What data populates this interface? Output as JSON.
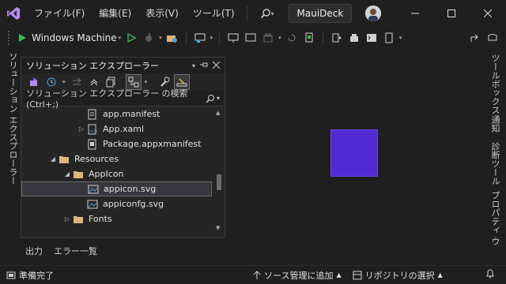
{
  "menu": [
    "ファイル(F)",
    "編集(E)",
    "表示(V)",
    "ツール(T)"
  ],
  "solution_name": "MauiDeck",
  "toolbar": {
    "run_target": "Windows Machine"
  },
  "left_rail": {
    "label": "ソリューション エクスプローラー"
  },
  "right_rail": [
    "ツールボックス",
    "通知",
    "診断ツール",
    "プロパティ ウ"
  ],
  "solution_explorer": {
    "title": "ソリューション エクスプローラー",
    "search_placeholder": "ソリューション エクスプローラー の検索 (Ctrl+;)",
    "items": [
      {
        "label": "app.manifest",
        "indent": 3,
        "arrow": "",
        "icon": "manifest-file-icon"
      },
      {
        "label": "App.xaml",
        "indent": 3,
        "arrow": "▷",
        "icon": "xaml-file-icon"
      },
      {
        "label": "Package.appxmanifest",
        "indent": 3,
        "arrow": "",
        "icon": "appx-manifest-icon"
      },
      {
        "label": "Resources",
        "indent": 1,
        "arrow": "◢",
        "icon": "folder-icon"
      },
      {
        "label": "AppIcon",
        "indent": 2,
        "arrow": "◢",
        "icon": "folder-icon"
      },
      {
        "label": "appicon.svg",
        "indent": 3,
        "arrow": "",
        "icon": "svg-image-icon",
        "selected": true
      },
      {
        "label": "appiconfg.svg",
        "indent": 3,
        "arrow": "",
        "icon": "svg-image-icon"
      },
      {
        "label": "Fonts",
        "indent": 2,
        "arrow": "▷",
        "icon": "folder-icon"
      }
    ]
  },
  "output_tabs": [
    "出力",
    "エラー一覧"
  ],
  "status": {
    "ready": "準備完了",
    "source_control": "ソース管理に追加",
    "repository": "リポジトリの選択"
  },
  "colors": {
    "accent": "#512bd4",
    "vs_purple": "#8f5ee8"
  }
}
